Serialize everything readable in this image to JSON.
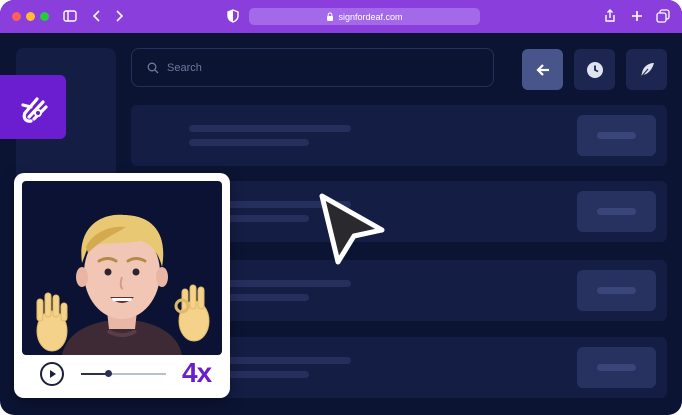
{
  "browser": {
    "url": "signfordeaf.com",
    "colors": {
      "titlebar": "#8a3fdc",
      "close": "#ff5f57",
      "minimize": "#febc2e",
      "zoom": "#28c840"
    }
  },
  "app": {
    "search_placeholder": "Search",
    "toolbar_buttons": [
      "back-arrow-icon",
      "clock-icon",
      "feather-icon"
    ],
    "rows": 4
  },
  "widget": {
    "logo": "signfordeaf-hand-logo",
    "speed_label": "4x",
    "progress": 0.3,
    "accent": "#6a1ed0"
  }
}
